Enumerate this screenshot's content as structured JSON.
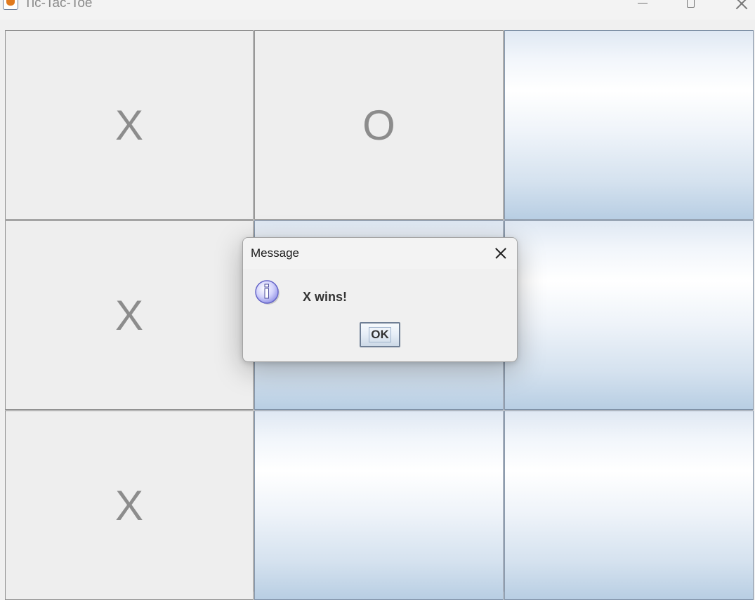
{
  "window": {
    "title": "Tic-Tac-Toe"
  },
  "board": {
    "cells": [
      "X",
      "O",
      "",
      "X",
      "",
      "",
      "X",
      "",
      ""
    ]
  },
  "dialog": {
    "title": "Message",
    "message": "X wins!",
    "ok_label": "OK",
    "icon": "info-icon"
  },
  "colors": {
    "mark": "#8c8c8c",
    "empty_cell_gradient_top": "#dfe8f3",
    "empty_cell_gradient_bottom": "#b8cee3",
    "info_icon": "#7a7ae0"
  }
}
